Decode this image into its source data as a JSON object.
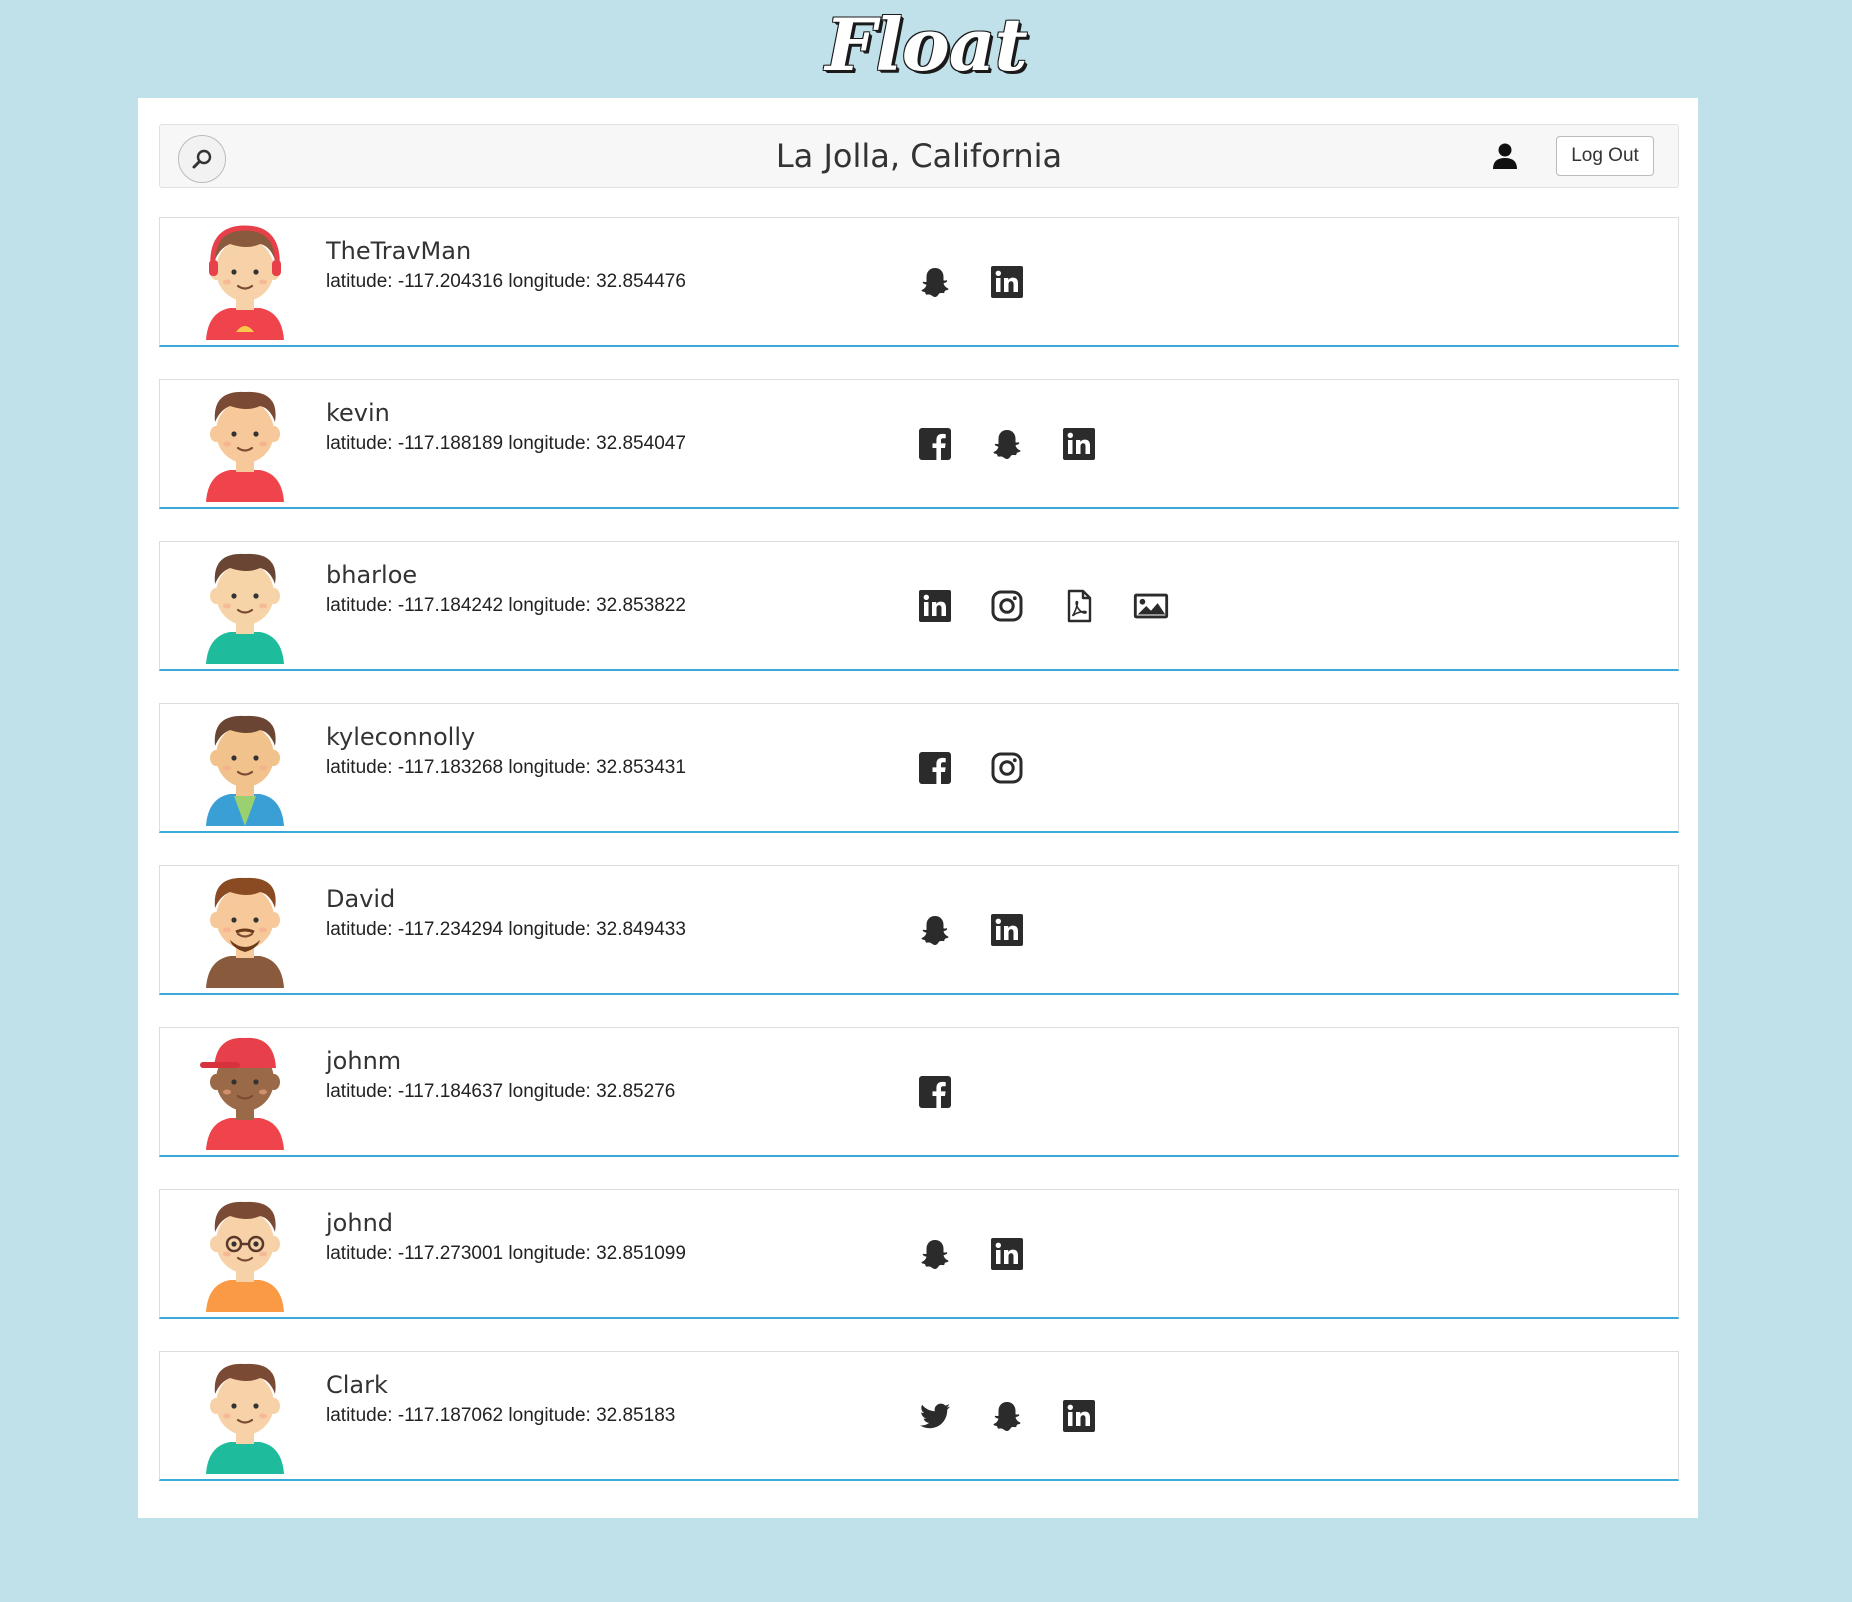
{
  "app": {
    "logo": "Float"
  },
  "header": {
    "location": "La Jolla, California",
    "logout_label": "Log Out"
  },
  "colors": {
    "background": "#c0e1ea",
    "accent": "#39a9d8",
    "icon": "#2b2b2b"
  },
  "users": [
    {
      "name": "TheTravMan",
      "coords": "latitude: -117.204316 longitude: 32.854476",
      "links": [
        "snapchat-icon",
        "linkedin-icon"
      ]
    },
    {
      "name": "kevin",
      "coords": "latitude: -117.188189 longitude: 32.854047",
      "links": [
        "facebook-icon",
        "snapchat-icon",
        "linkedin-icon"
      ]
    },
    {
      "name": "bharloe",
      "coords": "latitude: -117.184242 longitude: 32.853822",
      "links": [
        "linkedin-icon",
        "instagram-icon",
        "pdf-icon",
        "image-icon"
      ]
    },
    {
      "name": "kyleconnolly",
      "coords": "latitude: -117.183268 longitude: 32.853431",
      "links": [
        "facebook-icon",
        "instagram-icon"
      ]
    },
    {
      "name": "David",
      "coords": "latitude: -117.234294 longitude: 32.849433",
      "links": [
        "snapchat-icon",
        "linkedin-icon"
      ]
    },
    {
      "name": "johnm",
      "coords": "latitude: -117.184637 longitude: 32.85276",
      "links": [
        "facebook-icon"
      ]
    },
    {
      "name": "johnd",
      "coords": "latitude: -117.273001 longitude: 32.851099",
      "links": [
        "snapchat-icon",
        "linkedin-icon"
      ]
    },
    {
      "name": "Clark",
      "coords": "latitude: -117.187062 longitude: 32.85183",
      "links": [
        "twitter-icon",
        "snapchat-icon",
        "linkedin-icon"
      ]
    }
  ]
}
